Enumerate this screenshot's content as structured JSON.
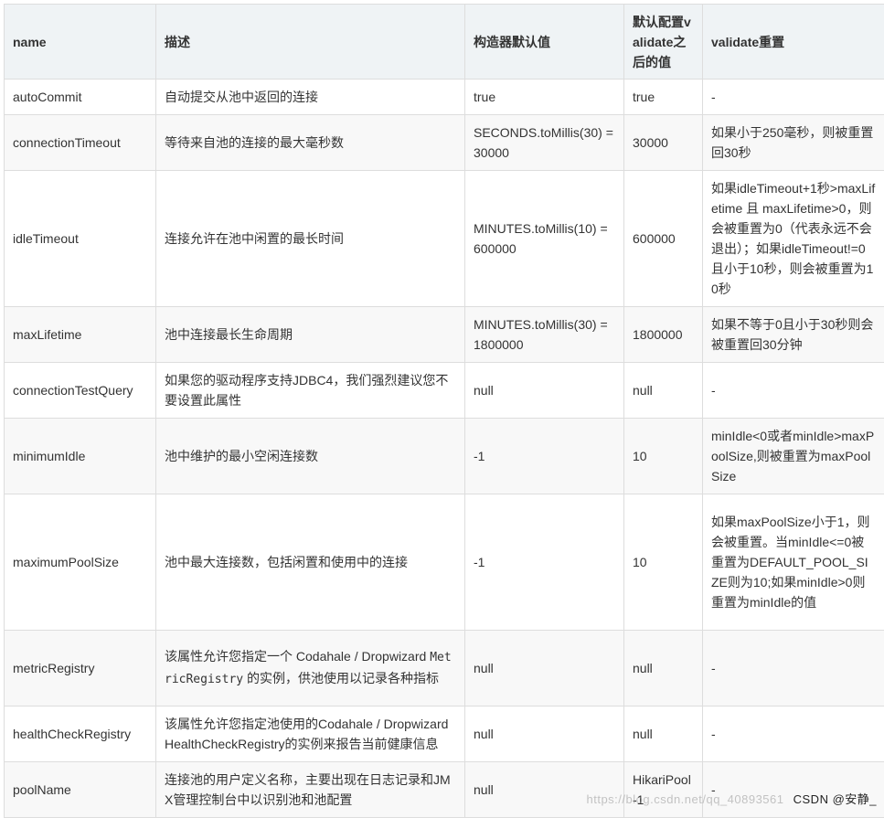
{
  "table": {
    "headers": [
      "name",
      "描述",
      "构造器默认值",
      "默认配置validate之后的值",
      "validate重置"
    ],
    "rows": [
      {
        "name": "autoCommit",
        "description": "自动提交从池中返回的连接",
        "constructor_default": "true",
        "validated_value": "true",
        "validate_reset": "-"
      },
      {
        "name": "connectionTimeout",
        "description": "等待来自池的连接的最大毫秒数",
        "constructor_default": "SECONDS.toMillis(30) = 30000",
        "validated_value": "30000",
        "validate_reset": "如果小于250毫秒，则被重置回30秒"
      },
      {
        "name": "idleTimeout",
        "description": "连接允许在池中闲置的最长时间",
        "constructor_default": "MINUTES.toMillis(10) = 600000",
        "validated_value": "600000",
        "validate_reset": "如果idleTimeout+1秒>maxLifetime 且 maxLifetime>0，则会被重置为0（代表永远不会退出）；如果idleTimeout!=0且小于10秒，则会被重置为10秒"
      },
      {
        "name": "maxLifetime",
        "description": "池中连接最长生命周期",
        "constructor_default": "MINUTES.toMillis(30) = 1800000",
        "validated_value": "1800000",
        "validate_reset": "如果不等于0且小于30秒则会被重置回30分钟"
      },
      {
        "name": "connectionTestQuery",
        "description": "如果您的驱动程序支持JDBC4，我们强烈建议您不要设置此属性",
        "constructor_default": "null",
        "validated_value": "null",
        "validate_reset": "-"
      },
      {
        "name": "minimumIdle",
        "description": "池中维护的最小空闲连接数",
        "constructor_default": "-1",
        "validated_value": "10",
        "validate_reset": "minIdle<0或者minIdle>maxPoolSize,则被重置为maxPoolSize"
      },
      {
        "name": "maximumPoolSize",
        "description": "池中最大连接数，包括闲置和使用中的连接",
        "constructor_default": "-1",
        "validated_value": "10",
        "validate_reset": "如果maxPoolSize小于1，则会被重置。当minIdle<=0被重置为DEFAULT_POOL_SIZE则为10;如果minIdle>0则重置为minIdle的值"
      },
      {
        "name": "metricRegistry",
        "description_parts": [
          "该属性允许您指定一个 Codahale / Dropwizard ",
          "MetricRegistry",
          " 的实例，供池使用以记录各种指标"
        ],
        "constructor_default": "null",
        "validated_value": "null",
        "validate_reset": "-"
      },
      {
        "name": "healthCheckRegistry",
        "description": "该属性允许您指定池使用的Codahale / Dropwizard HealthCheckRegistry的实例来报告当前健康信息",
        "constructor_default": "null",
        "validated_value": "null",
        "validate_reset": "-"
      },
      {
        "name": "poolName",
        "description": "连接池的用户定义名称，主要出现在日志记录和JMX管理控制台中以识别池和池配置",
        "constructor_default": "null",
        "validated_value": "HikariPool-1",
        "validate_reset": "-"
      }
    ]
  },
  "watermark": {
    "url": "https://blog.csdn.net/qq_40893561",
    "brand": "CSDN @安静_"
  }
}
